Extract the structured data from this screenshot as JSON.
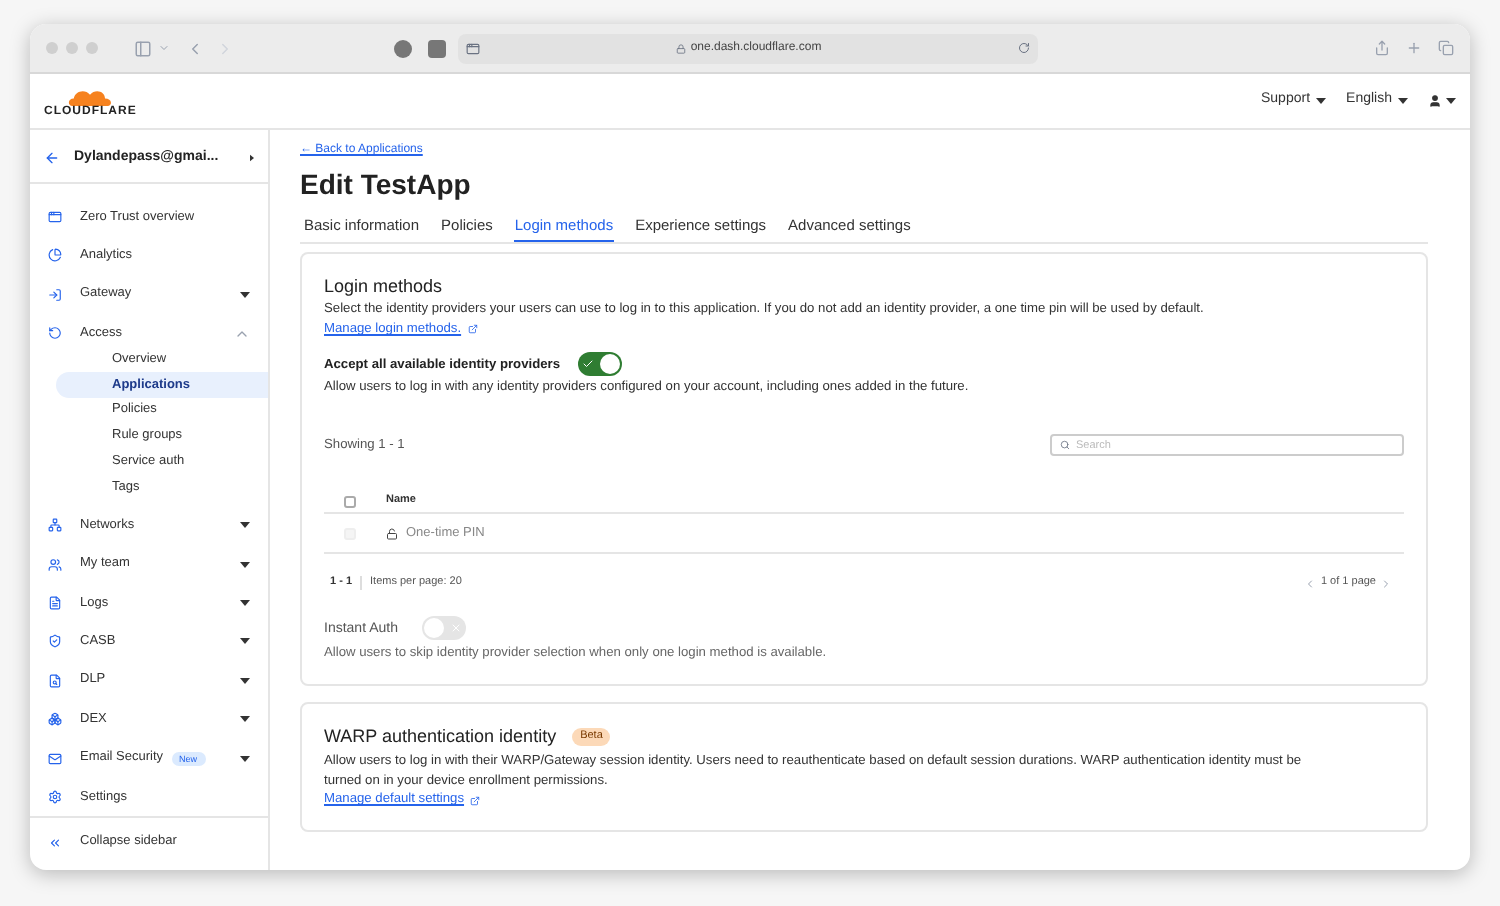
{
  "browser": {
    "url": "one.dash.cloudflare.com"
  },
  "header": {
    "logo_text": "CLOUDFLARE",
    "menus": [
      "Support",
      "English"
    ]
  },
  "account": {
    "name": "Dylandepass@gmai..."
  },
  "sidebar": {
    "items": [
      {
        "label": "Zero Trust overview"
      },
      {
        "label": "Analytics"
      },
      {
        "label": "Gateway",
        "expanded": false
      },
      {
        "label": "Access",
        "expanded": true,
        "children": [
          {
            "label": "Overview",
            "selected": false
          },
          {
            "label": "Applications",
            "selected": true
          },
          {
            "label": "Policies",
            "selected": false
          },
          {
            "label": "Rule groups",
            "selected": false
          },
          {
            "label": "Service auth",
            "selected": false
          },
          {
            "label": "Tags",
            "selected": false
          }
        ]
      },
      {
        "label": "Networks",
        "expanded": false
      },
      {
        "label": "My team",
        "expanded": false
      },
      {
        "label": "Logs",
        "expanded": false
      },
      {
        "label": "CASB",
        "expanded": false
      },
      {
        "label": "DLP",
        "expanded": false
      },
      {
        "label": "DEX",
        "expanded": false
      },
      {
        "label": "Email Security",
        "badge": "New",
        "expanded": false
      },
      {
        "label": "Settings"
      }
    ],
    "collapse": "Collapse sidebar"
  },
  "back_link": "← Back to Applications",
  "title": "Edit TestApp",
  "tabs": [
    {
      "label": "Basic information",
      "selected": false
    },
    {
      "label": "Policies",
      "selected": false
    },
    {
      "label": "Login methods",
      "selected": true
    },
    {
      "label": "Experience settings",
      "selected": false
    },
    {
      "label": "Advanced settings",
      "selected": false
    }
  ],
  "login_methods": {
    "title": "Login methods",
    "description": "Select the identity providers your users can use to log in to this application. If you do not add an identity provider, a one time pin will be used by default.",
    "link": "Manage login methods.",
    "accept_all": {
      "label": "Accept all available identity providers",
      "on": true,
      "help": "Allow users to log in with any identity providers configured on your account, including ones added in the future."
    },
    "showing": "Showing 1 - 1",
    "search": {
      "placeholder": "Search"
    },
    "table": {
      "header_checked": false,
      "columns": [
        "Name"
      ],
      "rows": [
        {
          "name": "One-time PIN",
          "checked": false,
          "disabled": true
        }
      ]
    },
    "pagination": {
      "range": "1 - 1",
      "per_page": "Items per page: 20",
      "page": "1 of 1 page"
    },
    "instant_auth": {
      "label": "Instant Auth",
      "on": false,
      "help": "Allow users to skip identity provider selection when only one login method is available."
    }
  },
  "warp": {
    "title": "WARP authentication identity",
    "badge": "Beta",
    "description": "Allow users to log in with their WARP/Gateway session identity. Users need to reauthenticate based on default session durations. WARP authentication identity must be turned on in your device enrollment permissions.",
    "link": "Manage default settings"
  }
}
